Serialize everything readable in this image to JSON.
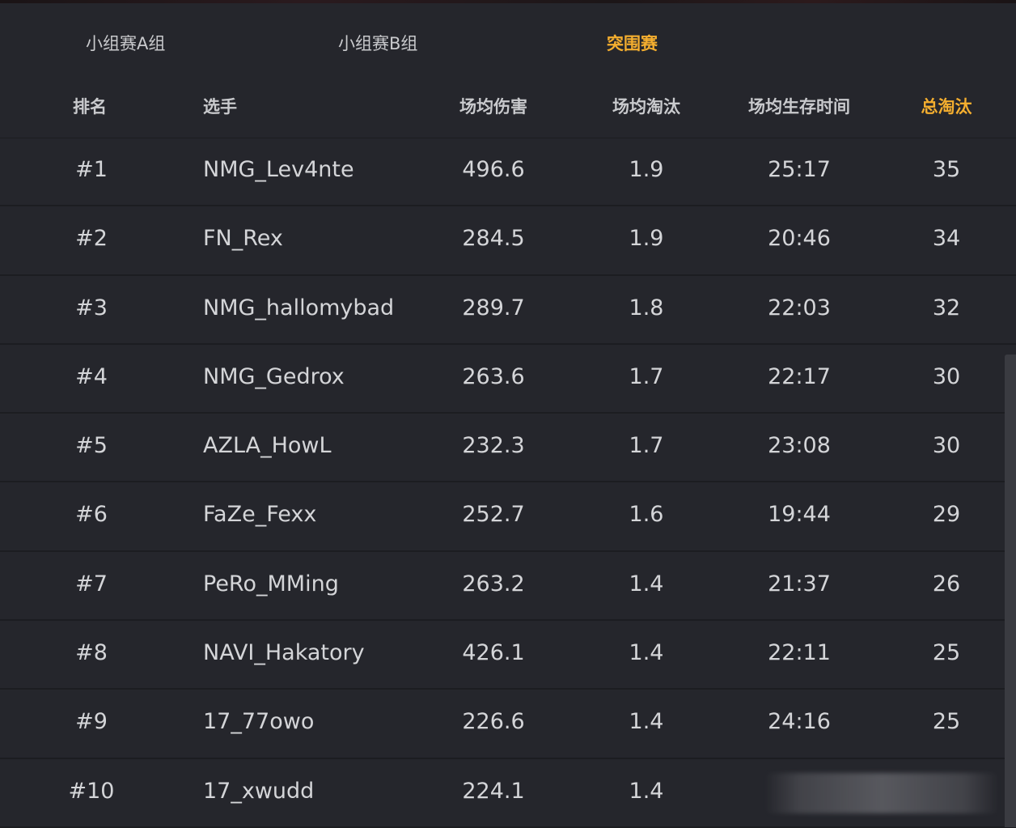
{
  "tabs": [
    {
      "label": "小组赛A组",
      "active": false
    },
    {
      "label": "小组赛B组",
      "active": false
    },
    {
      "label": "突围赛",
      "active": true
    }
  ],
  "columns": {
    "rank": "排名",
    "player": "选手",
    "avg_damage": "场均伤害",
    "avg_kills": "场均淘汰",
    "avg_survival": "场均生存时间",
    "total_kills": "总淘汰"
  },
  "rows": [
    {
      "rank": "#1",
      "player": "NMG_Lev4nte",
      "avg_damage": "496.6",
      "avg_kills": "1.9",
      "avg_survival": "25:17",
      "total_kills": "35"
    },
    {
      "rank": "#2",
      "player": "FN_Rex",
      "avg_damage": "284.5",
      "avg_kills": "1.9",
      "avg_survival": "20:46",
      "total_kills": "34"
    },
    {
      "rank": "#3",
      "player": "NMG_hallomybad",
      "avg_damage": "289.7",
      "avg_kills": "1.8",
      "avg_survival": "22:03",
      "total_kills": "32"
    },
    {
      "rank": "#4",
      "player": "NMG_Gedrox",
      "avg_damage": "263.6",
      "avg_kills": "1.7",
      "avg_survival": "22:17",
      "total_kills": "30"
    },
    {
      "rank": "#5",
      "player": "AZLA_HowL",
      "avg_damage": "232.3",
      "avg_kills": "1.7",
      "avg_survival": "23:08",
      "total_kills": "30"
    },
    {
      "rank": "#6",
      "player": "FaZe_Fexx",
      "avg_damage": "252.7",
      "avg_kills": "1.6",
      "avg_survival": "19:44",
      "total_kills": "29"
    },
    {
      "rank": "#7",
      "player": "PeRo_MMing",
      "avg_damage": "263.2",
      "avg_kills": "1.4",
      "avg_survival": "21:37",
      "total_kills": "26"
    },
    {
      "rank": "#8",
      "player": "NAVI_Hakatory",
      "avg_damage": "426.1",
      "avg_kills": "1.4",
      "avg_survival": "22:11",
      "total_kills": "25"
    },
    {
      "rank": "#9",
      "player": "17_77owo",
      "avg_damage": "226.6",
      "avg_kills": "1.4",
      "avg_survival": "24:16",
      "total_kills": "25"
    },
    {
      "rank": "#10",
      "player": "17_xwudd",
      "avg_damage": "224.1",
      "avg_kills": "1.4",
      "avg_survival": "",
      "total_kills": ""
    }
  ],
  "colors": {
    "background": "#25262c",
    "accent": "#f4ae2f",
    "text": "#d4d5d8"
  }
}
